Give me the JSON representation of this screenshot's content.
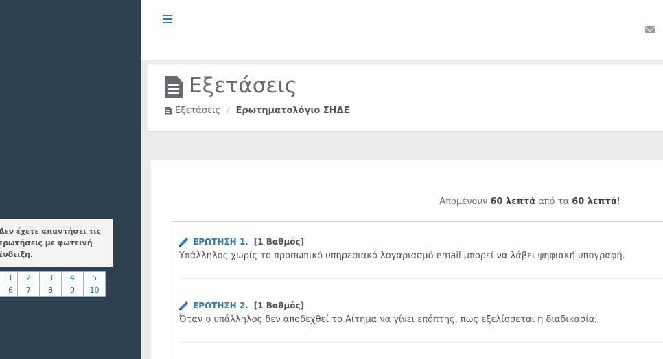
{
  "sidebar": {
    "notice_lines": [
      "Δεν έχετε απαντήσει τις",
      "ερωτήσεις με φωτεινή",
      "ένδειξη."
    ],
    "question_numbers": [
      [
        "1",
        "2",
        "3",
        "4",
        "5"
      ],
      [
        "6",
        "7",
        "8",
        "9",
        "10"
      ]
    ]
  },
  "heading": {
    "title": "Εξετάσεις",
    "breadcrumb": {
      "home": "Εξετάσεις",
      "separator": "/",
      "current": "Ερωτηματολόγιο ΣΗΔΕ"
    }
  },
  "timer": {
    "prefix": "Απομένουν",
    "remaining": "60 λεπτά",
    "middle": "από τα",
    "total": "60 λεπτά",
    "suffix": "!"
  },
  "questions": [
    {
      "label": "ΕΡΩΤΗΣΗ 1.",
      "points": "[1 Βαθμός]",
      "text": "Υπάλληλος χωρίς το προσωπικό υπηρεσιακό λογαριασμό email μπορεί να λάβει ψηφιακή υπογραφή."
    },
    {
      "label": "ΕΡΩΤΗΣΗ 2.",
      "points": "[1 Βαθμός]",
      "text": "Όταν ο υπάλληλος δεν αποδεχθεί το Αίτημα να γίνει επόπτης, πως εξελίσσεται η διαδικασία;"
    }
  ],
  "colors": {
    "sidebar": "#2f4050",
    "accent": "#337ab7"
  },
  "icons": {
    "menu": "hamburger-icon",
    "mail": "envelope-icon",
    "page": "file-text-icon",
    "question": "pencil-icon"
  }
}
